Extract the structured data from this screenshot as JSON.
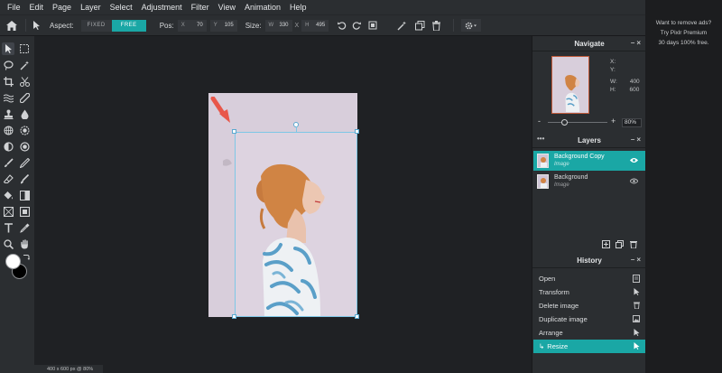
{
  "menu": [
    "File",
    "Edit",
    "Page",
    "Layer",
    "Select",
    "Adjustment",
    "Filter",
    "View",
    "Animation",
    "Help"
  ],
  "options": {
    "aspect_label": "Aspect:",
    "fixed": "FIXED",
    "free": "FREE",
    "pos_label": "Pos:",
    "x_label": "X",
    "x_value": "70",
    "y_label": "Y",
    "y_value": "105",
    "size_label": "Size:",
    "w_label": "W",
    "w_value": "330",
    "h_label": "H",
    "h_value": "495",
    "x_sep": "X"
  },
  "status": "400 x 600 px @ 80%",
  "navigate": {
    "title": "Navigate",
    "x_label": "X:",
    "y_label": "Y:",
    "w_label": "W:",
    "w_value": "400",
    "h_label": "H:",
    "h_value": "600",
    "zoom": "80%",
    "minus": "-",
    "plus": "+"
  },
  "layers": {
    "title": "Layers",
    "items": [
      {
        "name": "Background Copy",
        "type": "Image"
      },
      {
        "name": "Background",
        "type": "Image"
      }
    ]
  },
  "history": {
    "title": "History",
    "items": [
      "Open",
      "Transform",
      "Delete image",
      "Duplicate image",
      "Arrange",
      "Resize"
    ]
  },
  "ad": {
    "line1": "Want to remove ads?",
    "line2": "Try Pixlr Premium",
    "line3": "30 days 100% free."
  },
  "colors": {
    "accent": "#1aa7a5",
    "arrow": "#e8574a",
    "foreground": "#ffffff",
    "background": "#000000"
  }
}
